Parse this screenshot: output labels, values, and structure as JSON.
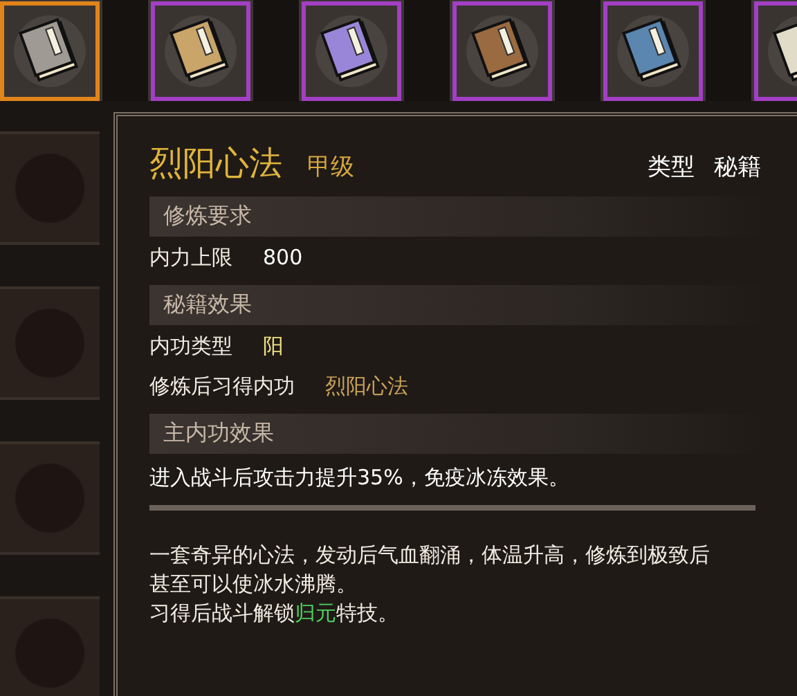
{
  "item_slots": [
    {
      "color": "#a09a94",
      "selected": true
    },
    {
      "color": "#c9a56a",
      "selected": false
    },
    {
      "color": "#9a86d8",
      "selected": false
    },
    {
      "color": "#9a6a40",
      "selected": false
    },
    {
      "color": "#5a86b0",
      "selected": false
    },
    {
      "color": "#e0dcc8",
      "selected": false
    }
  ],
  "tooltip": {
    "title": "烈阳心法",
    "grade": "甲级",
    "type_label": "类型",
    "type_value": "秘籍",
    "sections": [
      {
        "header": "修炼要求",
        "kind": "rows",
        "rows": [
          {
            "label": "内力上限",
            "value": "800",
            "kind": "plain"
          }
        ]
      },
      {
        "header": "秘籍效果",
        "kind": "rows",
        "rows": [
          {
            "label": "内功类型",
            "value": "阳",
            "kind": "highlight"
          },
          {
            "label": "修炼后习得内功",
            "value": "烈阳心法",
            "kind": "gold"
          }
        ]
      },
      {
        "header": "主内功效果",
        "kind": "text",
        "text": "进入战斗后攻击力提升35%，免疫冰冻效果。"
      }
    ],
    "description": [
      [
        {
          "text": "一套奇异的心法，发动后气血翻涌，体温升高，修炼到极致后甚至可以使冰水沸腾。",
          "kind": "plain"
        }
      ],
      [
        {
          "text": "习得后战斗解锁",
          "kind": "plain"
        },
        {
          "text": "归元",
          "kind": "green"
        },
        {
          "text": "特技。",
          "kind": "plain"
        }
      ]
    ]
  }
}
